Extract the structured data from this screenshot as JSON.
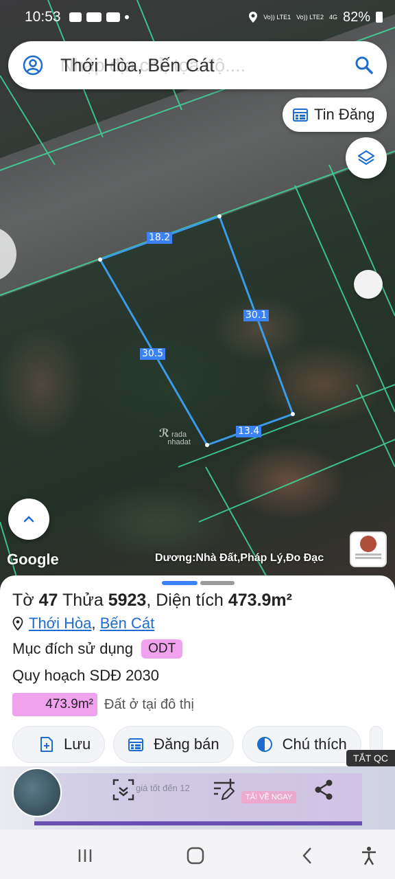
{
  "status_bar": {
    "time": "10:53",
    "sim1": "Vo)) LTE1",
    "sim2": "Vo)) LTE2",
    "net": "4G",
    "battery": "82%"
  },
  "search": {
    "value": "Thới Hòa, Bến Cát",
    "placeholder": "Nhập địa chỉ, tọa độ...."
  },
  "map": {
    "tin_dang_label": "Tin Đăng",
    "dimensions": [
      "18.2",
      "30.1",
      "30.5",
      "13.4"
    ],
    "watermark_top": "rada",
    "watermark_bottom": "nhadat",
    "google_logo": "Google",
    "attribution": "Dương:Nhà Đất,Pháp Lý,Đo Đạc"
  },
  "parcel": {
    "to_label": "Tờ",
    "to_value": "47",
    "thua_label": "Thửa",
    "thua_value": "5923",
    "area_label": "Diện tích",
    "area_value": "473.9m²",
    "location_commune": "Thới Hòa",
    "location_district": "Bến Cát",
    "location_sep": ",",
    "purpose_label": "Mục đích sử dụng",
    "purpose_code": "ODT",
    "plan_label": "Quy hoạch SDĐ 2030",
    "plan_area": "473.9m²",
    "plan_desc": "Đất ở tại đô thị"
  },
  "actions": {
    "save": "Lưu",
    "post": "Đăng bán",
    "legend": "Chú thích"
  },
  "ad": {
    "close_label": "TẮT QC",
    "text": "giá tốt đến 12",
    "cta": "TẢI VỀ NGAY"
  },
  "colors": {
    "accent": "#3b82f6",
    "odt": "#f0a2ef",
    "link": "#1e6ccf",
    "grid": "#3fd99a"
  }
}
